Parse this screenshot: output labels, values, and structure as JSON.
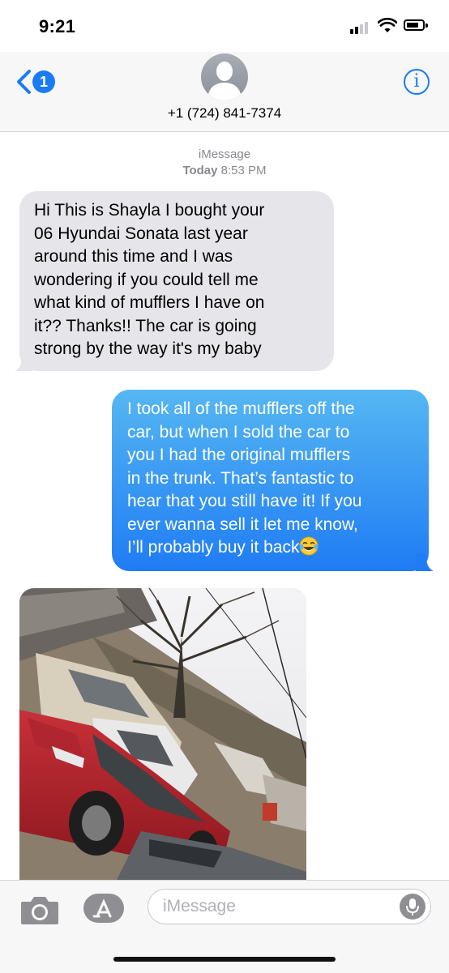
{
  "status_bar": {
    "time": "9:21",
    "icons": [
      "signal-icon",
      "wifi-icon",
      "battery-icon"
    ]
  },
  "header": {
    "back_badge": "1",
    "contact": "+1 (724) 841-7374",
    "info_icon": "i",
    "accent": "#1a7cf5"
  },
  "conversation": {
    "service": "iMessage",
    "timestamp_day": "Today",
    "timestamp_time": "8:53 PM",
    "messages": [
      {
        "direction": "received",
        "lines": [
          "Hi This is Shayla I bought your",
          "06 Hyundai Sonata last year",
          "around this time and I was",
          "wondering if you could tell me",
          "what kind of mufflers I have on",
          "it?? Thanks!! The car is going",
          "strong by the way it's my baby"
        ]
      },
      {
        "direction": "sent",
        "lines": [
          "I took all of the mufflers off the",
          "car, but when I sold the car to",
          "you I had the original mufflers",
          "in the trunk. That’s fantastic to",
          "hear that you still have it! If you",
          "ever wanna sell it let me know,",
          "I’ll probably buy it back"
        ],
        "trailing_emoji": "tears-of-joy-emoji"
      },
      {
        "direction": "received",
        "type": "photo",
        "depicts": "photo-of-parked-red-sedan"
      }
    ],
    "colors": {
      "received_bubble": "#e5e5ea",
      "sent_bubble_top": "#56b7f2",
      "sent_bubble_bottom": "#1f7cf4"
    }
  },
  "input_bar": {
    "placeholder": "iMessage",
    "icons": [
      "camera-icon",
      "app-store-icon",
      "microphone-icon"
    ]
  }
}
